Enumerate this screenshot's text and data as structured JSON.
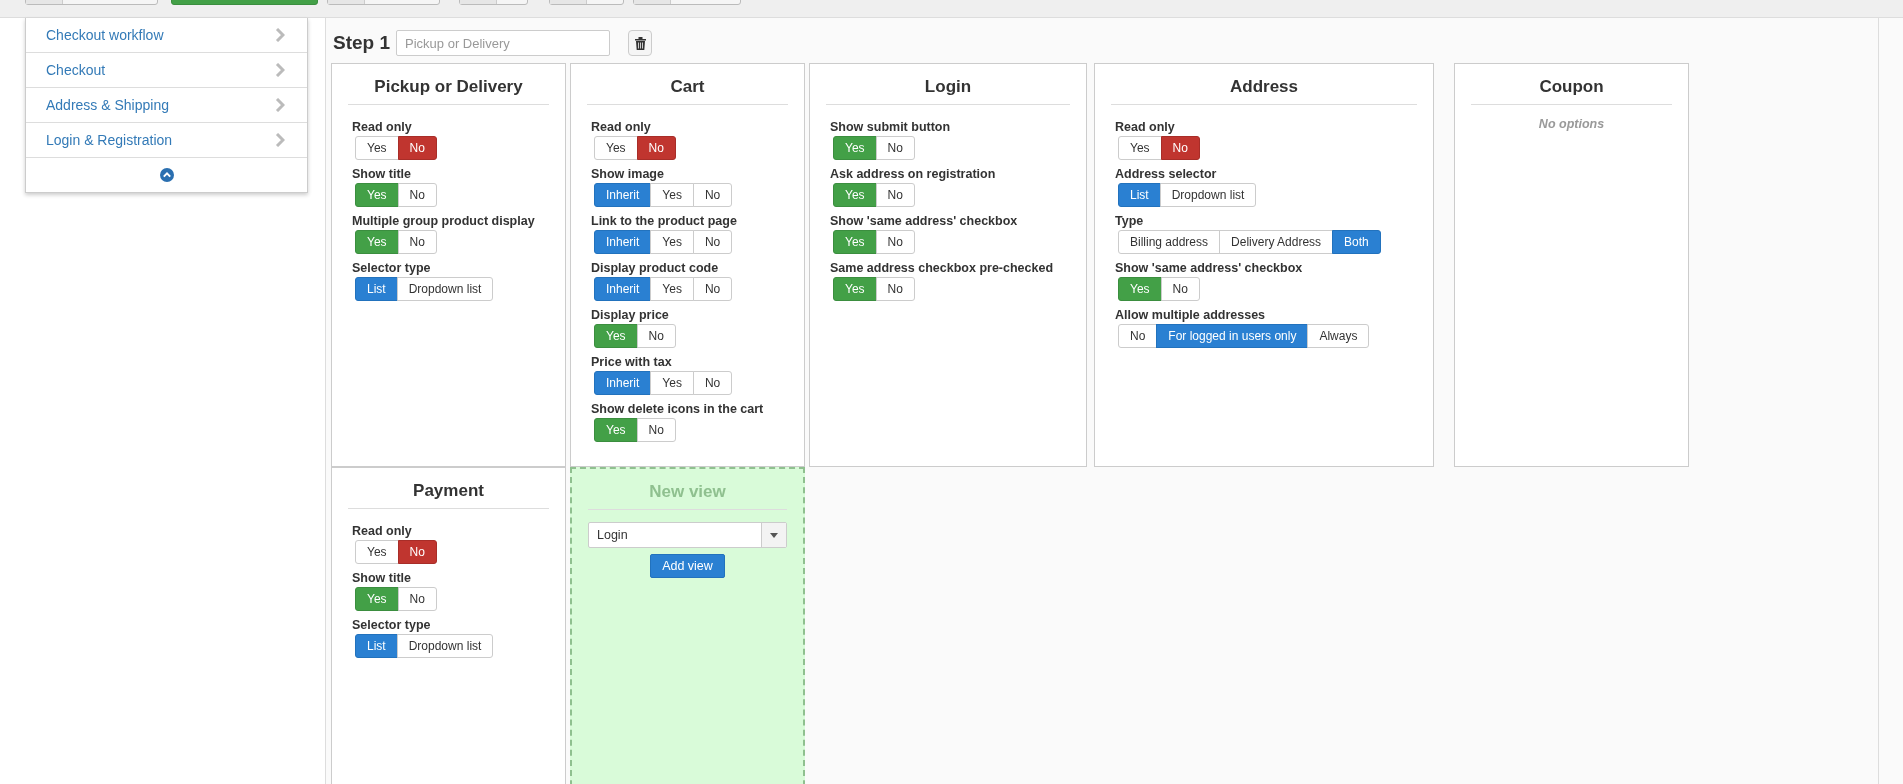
{
  "toolbar": {
    "buttons": [
      {
        "kind": "default"
      },
      {
        "kind": "success"
      },
      {
        "kind": "default"
      },
      {
        "kind": "default"
      },
      {
        "kind": "default"
      },
      {
        "kind": "default"
      }
    ]
  },
  "sidebar": {
    "items": [
      {
        "label": "Checkout workflow"
      },
      {
        "label": "Checkout"
      },
      {
        "label": "Address & Shipping"
      },
      {
        "label": "Login & Registration"
      }
    ]
  },
  "step": {
    "label": "Step 1",
    "placeholder": "Pickup or Delivery"
  },
  "rows": [
    {
      "views": [
        {
          "kind": "view",
          "title": "Pickup or Delivery",
          "settings": [
            {
              "label": "Read only",
              "options": [
                {
                  "label": "Yes",
                  "kind": "yes",
                  "selected": false
                },
                {
                  "label": "No",
                  "kind": "no",
                  "selected": true
                }
              ]
            },
            {
              "label": "Show title",
              "options": [
                {
                  "label": "Yes",
                  "kind": "yes",
                  "selected": true
                },
                {
                  "label": "No",
                  "kind": "no",
                  "selected": false
                }
              ]
            },
            {
              "label": "Multiple group product display",
              "options": [
                {
                  "label": "Yes",
                  "kind": "yes",
                  "selected": true
                },
                {
                  "label": "No",
                  "kind": "no",
                  "selected": false
                }
              ]
            },
            {
              "label": "Selector type",
              "options": [
                {
                  "label": "List",
                  "kind": "choice",
                  "selected": true
                },
                {
                  "label": "Dropdown list",
                  "kind": "choice",
                  "selected": false
                }
              ]
            }
          ]
        },
        {
          "kind": "view",
          "title": "Cart",
          "settings": [
            {
              "label": "Read only",
              "options": [
                {
                  "label": "Yes",
                  "kind": "yes",
                  "selected": false
                },
                {
                  "label": "No",
                  "kind": "no",
                  "selected": true
                }
              ]
            },
            {
              "label": "Show image",
              "options": [
                {
                  "label": "Inherit",
                  "kind": "choice",
                  "selected": true
                },
                {
                  "label": "Yes",
                  "kind": "yes",
                  "selected": false
                },
                {
                  "label": "No",
                  "kind": "no",
                  "selected": false
                }
              ]
            },
            {
              "label": "Link to the product page",
              "options": [
                {
                  "label": "Inherit",
                  "kind": "choice",
                  "selected": true
                },
                {
                  "label": "Yes",
                  "kind": "yes",
                  "selected": false
                },
                {
                  "label": "No",
                  "kind": "no",
                  "selected": false
                }
              ]
            },
            {
              "label": "Display product code",
              "options": [
                {
                  "label": "Inherit",
                  "kind": "choice",
                  "selected": true
                },
                {
                  "label": "Yes",
                  "kind": "yes",
                  "selected": false
                },
                {
                  "label": "No",
                  "kind": "no",
                  "selected": false
                }
              ]
            },
            {
              "label": "Display price",
              "options": [
                {
                  "label": "Yes",
                  "kind": "yes",
                  "selected": true
                },
                {
                  "label": "No",
                  "kind": "no",
                  "selected": false
                }
              ]
            },
            {
              "label": "Price with tax",
              "options": [
                {
                  "label": "Inherit",
                  "kind": "choice",
                  "selected": true
                },
                {
                  "label": "Yes",
                  "kind": "yes",
                  "selected": false
                },
                {
                  "label": "No",
                  "kind": "no",
                  "selected": false
                }
              ]
            },
            {
              "label": "Show delete icons in the cart",
              "options": [
                {
                  "label": "Yes",
                  "kind": "yes",
                  "selected": true
                },
                {
                  "label": "No",
                  "kind": "no",
                  "selected": false
                }
              ]
            }
          ]
        },
        {
          "kind": "view",
          "title": "Login",
          "settings": [
            {
              "label": "Show submit button",
              "options": [
                {
                  "label": "Yes",
                  "kind": "yes",
                  "selected": true
                },
                {
                  "label": "No",
                  "kind": "no",
                  "selected": false
                }
              ]
            },
            {
              "label": "Ask address on registration",
              "options": [
                {
                  "label": "Yes",
                  "kind": "yes",
                  "selected": true
                },
                {
                  "label": "No",
                  "kind": "no",
                  "selected": false
                }
              ]
            },
            {
              "label": "Show 'same address' checkbox",
              "options": [
                {
                  "label": "Yes",
                  "kind": "yes",
                  "selected": true
                },
                {
                  "label": "No",
                  "kind": "no",
                  "selected": false
                }
              ]
            },
            {
              "label": "Same address checkbox pre-checked",
              "options": [
                {
                  "label": "Yes",
                  "kind": "yes",
                  "selected": true
                },
                {
                  "label": "No",
                  "kind": "no",
                  "selected": false
                }
              ]
            }
          ]
        },
        {
          "kind": "view",
          "title": "Address",
          "settings": [
            {
              "label": "Read only",
              "options": [
                {
                  "label": "Yes",
                  "kind": "yes",
                  "selected": false
                },
                {
                  "label": "No",
                  "kind": "no",
                  "selected": true
                }
              ]
            },
            {
              "label": "Address selector",
              "options": [
                {
                  "label": "List",
                  "kind": "choice",
                  "selected": true
                },
                {
                  "label": "Dropdown list",
                  "kind": "choice",
                  "selected": false
                }
              ]
            },
            {
              "label": "Type",
              "options": [
                {
                  "label": "Billing address",
                  "kind": "choice",
                  "selected": false
                },
                {
                  "label": "Delivery Address",
                  "kind": "choice",
                  "selected": false
                },
                {
                  "label": "Both",
                  "kind": "choice",
                  "selected": true
                }
              ]
            },
            {
              "label": "Show 'same address' checkbox",
              "options": [
                {
                  "label": "Yes",
                  "kind": "yes",
                  "selected": true
                },
                {
                  "label": "No",
                  "kind": "no",
                  "selected": false
                }
              ]
            },
            {
              "label": "Allow multiple addresses",
              "options": [
                {
                  "label": "No",
                  "kind": "choice",
                  "selected": false
                },
                {
                  "label": "For logged in users only",
                  "kind": "choice",
                  "selected": true
                },
                {
                  "label": "Always",
                  "kind": "choice",
                  "selected": false
                }
              ]
            }
          ]
        },
        {
          "kind": "view",
          "title": "Coupon",
          "note": "No options"
        }
      ]
    },
    {
      "views": [
        {
          "kind": "view",
          "title": "Payment",
          "settings": [
            {
              "label": "Read only",
              "options": [
                {
                  "label": "Yes",
                  "kind": "yes",
                  "selected": false
                },
                {
                  "label": "No",
                  "kind": "no",
                  "selected": true
                }
              ]
            },
            {
              "label": "Show title",
              "options": [
                {
                  "label": "Yes",
                  "kind": "yes",
                  "selected": true
                },
                {
                  "label": "No",
                  "kind": "no",
                  "selected": false
                }
              ]
            },
            {
              "label": "Selector type",
              "options": [
                {
                  "label": "List",
                  "kind": "choice",
                  "selected": true
                },
                {
                  "label": "Dropdown list",
                  "kind": "choice",
                  "selected": false
                }
              ]
            }
          ]
        },
        {
          "kind": "new_view",
          "title": "New view",
          "select_value": "Login",
          "button": "Add view"
        }
      ]
    }
  ]
}
